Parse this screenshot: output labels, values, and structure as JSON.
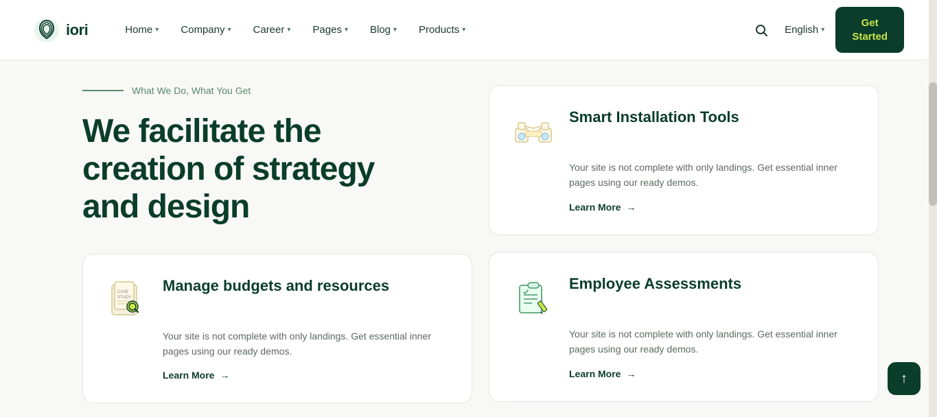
{
  "brand": {
    "logo_text": "iori",
    "logo_alt": "iori logo"
  },
  "nav": {
    "items": [
      {
        "label": "Home",
        "has_dropdown": true
      },
      {
        "label": "Company",
        "has_dropdown": true
      },
      {
        "label": "Career",
        "has_dropdown": true
      },
      {
        "label": "Pages",
        "has_dropdown": true
      },
      {
        "label": "Blog",
        "has_dropdown": true
      },
      {
        "label": "Products",
        "has_dropdown": true
      }
    ],
    "language": "English",
    "cta_line1": "Get",
    "cta_line2": "Started"
  },
  "hero": {
    "section_label": "What We Do, What You Get",
    "heading_line1": "We facilitate the",
    "heading_line2": "creation of strategy",
    "heading_line3": "and design"
  },
  "cards": {
    "smart_installation": {
      "title": "Smart Installation Tools",
      "description": "Your site is not complete with only landings. Get essential inner pages using our ready demos.",
      "learn_more": "Learn More"
    },
    "manage_budgets": {
      "title": "Manage budgets and resources",
      "description": "Your site is not complete with only landings. Get essential inner pages using our ready demos.",
      "learn_more": "Learn More"
    },
    "employee_assessments": {
      "title": "Employee Assessments",
      "description": "Your site is not complete with only landings. Get essential inner pages using our ready demos.",
      "learn_more": "Learn More"
    }
  },
  "colors": {
    "dark_green": "#0a3d2b",
    "accent_yellow": "#c8e64a",
    "mid_green": "#5a8a6a",
    "light_bg": "#f8f8f6"
  }
}
